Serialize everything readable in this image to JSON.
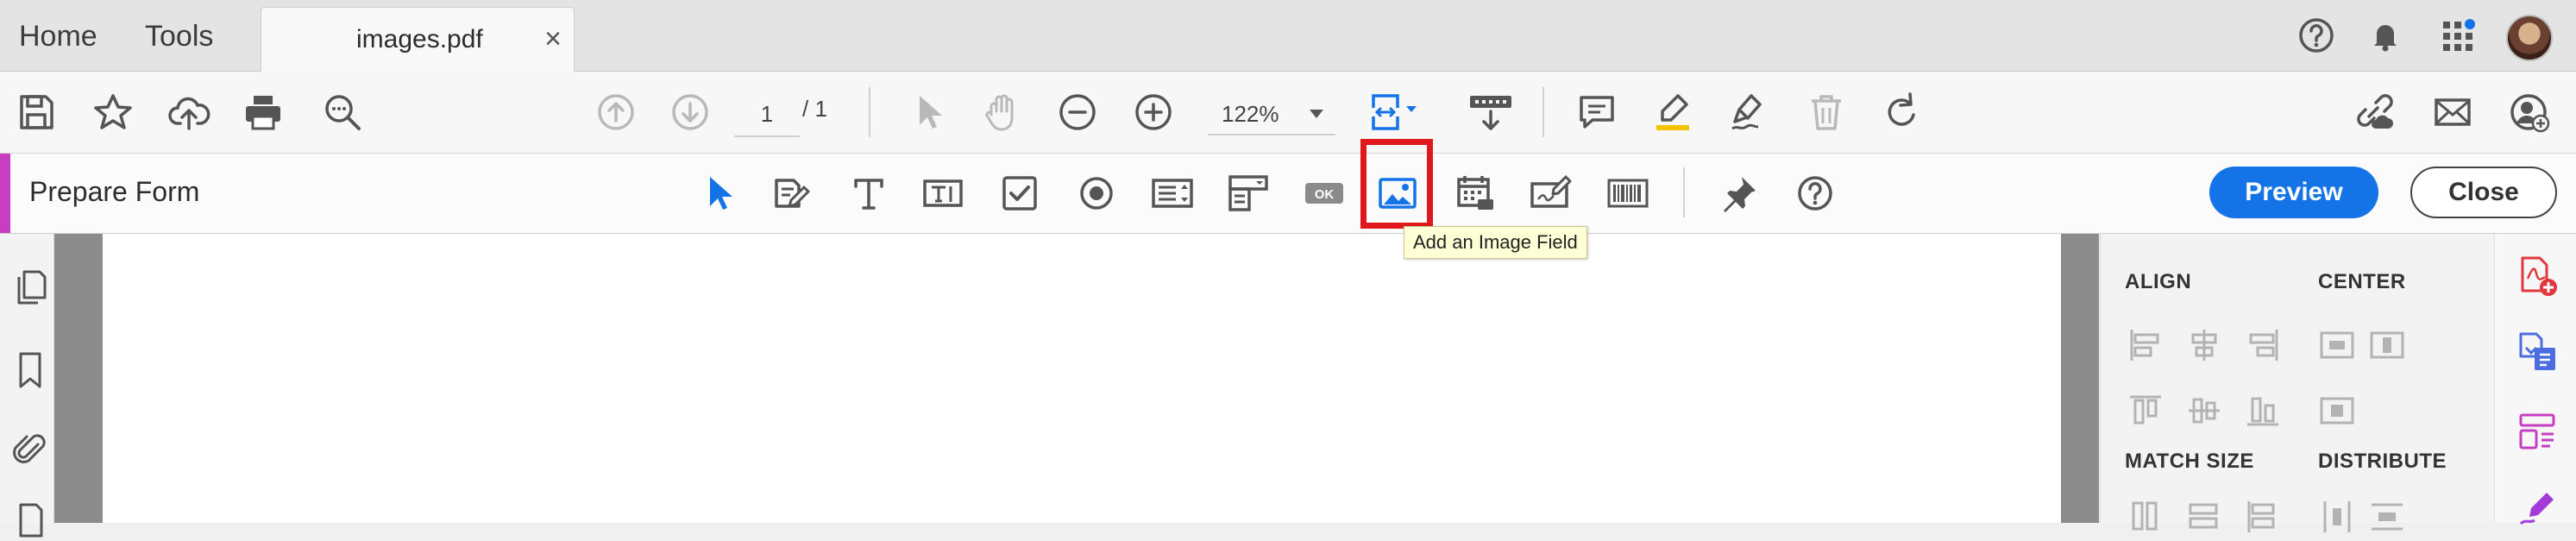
{
  "tabbar": {
    "home_label": "Home",
    "tools_label": "Tools",
    "document_tab": {
      "title": "images.pdf",
      "close_glyph": "×"
    },
    "right_icons": [
      "help-icon",
      "bell-icon",
      "apps-grid-icon",
      "avatar"
    ]
  },
  "toolbar": {
    "icons": [
      "save-icon",
      "star-icon",
      "cloud-upload-icon",
      "print-icon",
      "zoom-search-icon",
      "page-up-icon",
      "page-down-icon"
    ],
    "page_current": "1",
    "page_total": "/ 1",
    "zoom_value": "122%",
    "right_icons": [
      "comment-icon",
      "highlight-icon",
      "sign-icon",
      "delete-icon",
      "rotate-icon",
      "share-link-icon",
      "mail-icon",
      "add-user-icon"
    ]
  },
  "prepare_form": {
    "title": "Prepare Form",
    "tools": [
      "select-icon",
      "edit-form-icon",
      "text-icon",
      "text-field-icon",
      "checkbox-icon",
      "radio-icon",
      "list-box-icon",
      "dropdown-icon",
      "ok-button-icon",
      "image-field-icon",
      "date-field-icon",
      "signature-icon",
      "barcode-icon",
      "pin-icon",
      "help-icon"
    ],
    "button_field_label": "OK",
    "tooltip": "Add an Image Field",
    "preview_label": "Preview",
    "close_label": "Close"
  },
  "right_panel": {
    "align_label": "ALIGN",
    "center_label": "CENTER",
    "match_size_label": "MATCH SIZE",
    "distribute_label": "DISTRIBUTE"
  },
  "colors": {
    "accent_blue": "#1473e6",
    "prepare_form_accent": "#c63fc2",
    "highlight_red": "#e0181e",
    "tooltip_bg": "#ffffd6"
  }
}
